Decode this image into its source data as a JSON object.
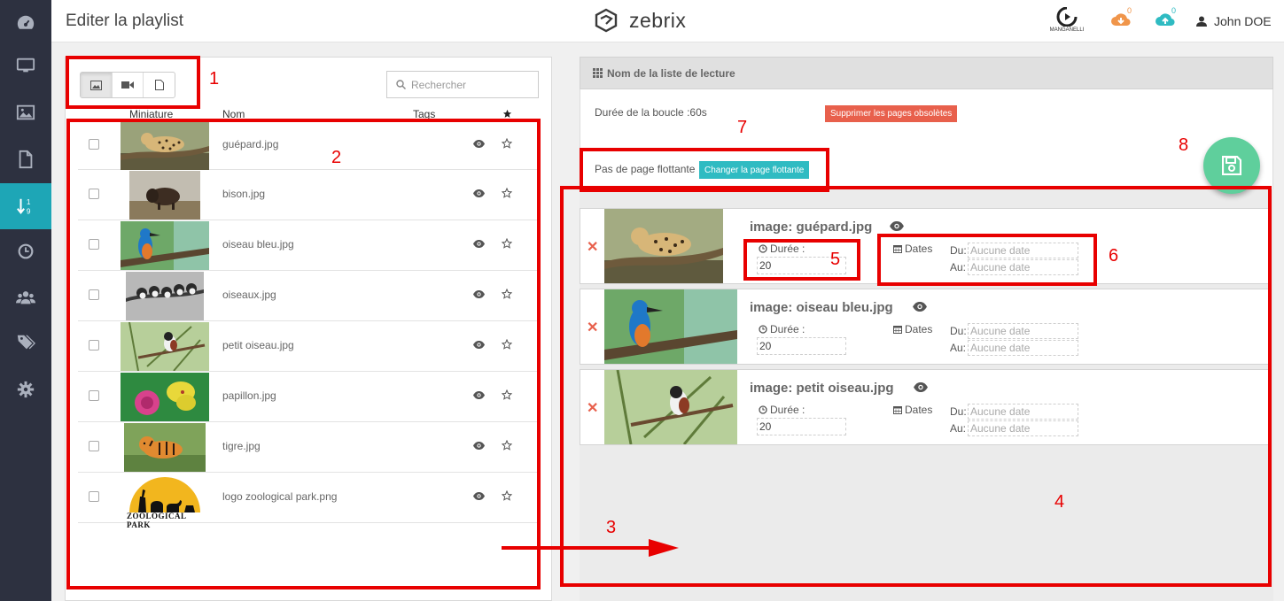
{
  "header": {
    "title": "Editer la playlist",
    "logo_text": "zebrix",
    "brand_text": "MANGANELLI",
    "download_count": "0",
    "upload_count": "0",
    "user_name": "John DOE"
  },
  "sidebar": {
    "items": [
      {
        "icon": "dashboard-icon"
      },
      {
        "icon": "monitor-icon"
      },
      {
        "icon": "image-icon"
      },
      {
        "icon": "page-icon"
      },
      {
        "icon": "sort-numeric-icon",
        "active": true
      },
      {
        "icon": "clock-icon"
      },
      {
        "icon": "users-icon"
      },
      {
        "icon": "tags-icon"
      },
      {
        "icon": "gear-icon"
      }
    ]
  },
  "library": {
    "search_placeholder": "Rechercher",
    "columns": {
      "thumbnail": "Miniature",
      "name": "Nom",
      "tags": "Tags"
    },
    "files": [
      {
        "name": "guépard.jpg",
        "thumb": "cheetah"
      },
      {
        "name": "bison.jpg",
        "thumb": "bison"
      },
      {
        "name": "oiseau bleu.jpg",
        "thumb": "kingfisher"
      },
      {
        "name": "oiseaux.jpg",
        "thumb": "birds"
      },
      {
        "name": "petit oiseau.jpg",
        "thumb": "small-bird"
      },
      {
        "name": "papillon.jpg",
        "thumb": "butterfly"
      },
      {
        "name": "tigre.jpg",
        "thumb": "tiger"
      },
      {
        "name": "logo zoological park.png",
        "thumb": "zoo-logo"
      }
    ],
    "zoo_logo_text": "ZOOLOGICAL PARK"
  },
  "playlist": {
    "header": "Nom de la liste de lecture",
    "loop_duration": "Durée de la boucle :60s",
    "delete_obsolete_label": "Supprimer les pages obsolètes",
    "floating_label": "Pas de page flottante",
    "change_floating_label": "Changer la page flottante",
    "items": [
      {
        "title": "image: guépard.jpg",
        "thumb": "cheetah",
        "duration_label": "Durée :",
        "duration": "20",
        "dates_label": "Dates",
        "du_label": "Du:",
        "au_label": "Au:",
        "du_placeholder": "Aucune date",
        "au_placeholder": "Aucune date"
      },
      {
        "title": "image: oiseau bleu.jpg",
        "thumb": "kingfisher",
        "duration_label": "Durée :",
        "duration": "20",
        "dates_label": "Dates",
        "du_label": "Du:",
        "au_label": "Au:",
        "du_placeholder": "Aucune date",
        "au_placeholder": "Aucune date"
      },
      {
        "title": "image: petit oiseau.jpg",
        "thumb": "small-bird",
        "duration_label": "Durée :",
        "duration": "20",
        "dates_label": "Dates",
        "du_label": "Du:",
        "au_label": "Au:",
        "du_placeholder": "Aucune date",
        "au_placeholder": "Aucune date"
      }
    ]
  },
  "annotations": [
    "1",
    "2",
    "3",
    "4",
    "5",
    "6",
    "7",
    "8"
  ],
  "colors": {
    "sidebar": "#2d3140",
    "active": "#1ea6b6",
    "danger": "#e8604c",
    "teal": "#2fbbc2",
    "save": "#5fcf9c",
    "annotation": "#e80000"
  }
}
